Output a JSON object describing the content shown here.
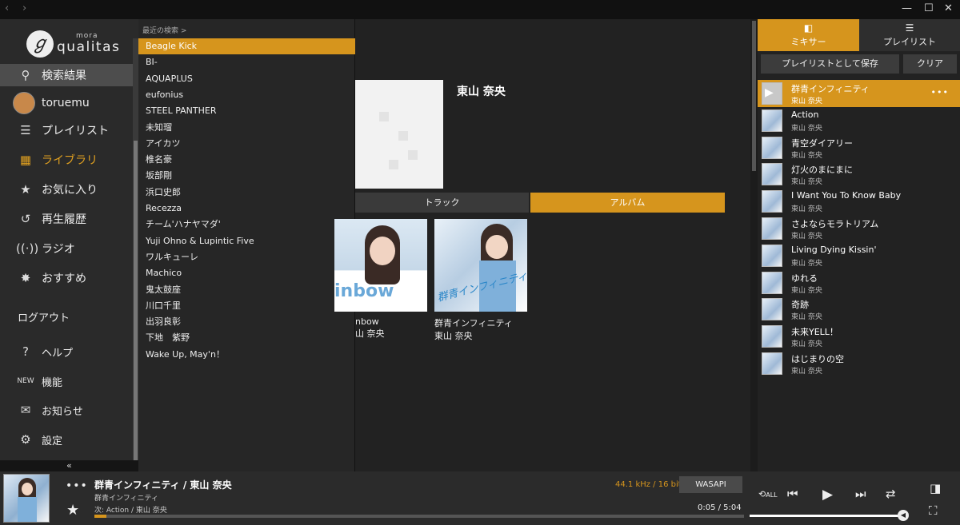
{
  "window": {
    "back": "‹",
    "forward": "›",
    "minimize": "—",
    "maximize": "☐",
    "close": "✕"
  },
  "sidebar": {
    "logo_small": "mora",
    "logo_main": "qualitas",
    "items": [
      {
        "label": "検索結果",
        "icon": "search-icon"
      },
      {
        "label": "toruemu",
        "icon": "avatar"
      },
      {
        "label": "プレイリスト",
        "icon": "playlist-icon"
      },
      {
        "label": "ライブラリ",
        "icon": "library-icon"
      },
      {
        "label": "お気に入り",
        "icon": "star-icon"
      },
      {
        "label": "再生履歴",
        "icon": "history-icon"
      },
      {
        "label": "ラジオ",
        "icon": "radio-icon"
      },
      {
        "label": "おすすめ",
        "icon": "recommend-icon"
      }
    ],
    "logout": "ログアウト",
    "lower_items": [
      {
        "label": "ヘルプ",
        "icon": "help-icon"
      },
      {
        "label": "機能",
        "icon": "new-icon"
      },
      {
        "label": "お知らせ",
        "icon": "mail-icon"
      },
      {
        "label": "設定",
        "icon": "gear-icon"
      }
    ],
    "collapse": "«"
  },
  "recent": {
    "header": "最近の検索 >",
    "items": [
      "Beagle Kick",
      "BI-",
      "AQUAPLUS",
      "eufonius",
      "STEEL PANTHER",
      "未知瑠",
      "アイカツ",
      "椎名豪",
      "坂部剛",
      "浜口史郎",
      "Recezza",
      "チーム'ハナヤマダ'",
      "Yuji Ohno & Lupintic Five",
      "ワルキューレ",
      "Machico",
      "鬼太鼓座",
      "川口千里",
      "出羽良彰",
      "下地　紫野",
      "Wake Up, May'n！"
    ]
  },
  "main": {
    "artist": "東山 奈央",
    "tabs": {
      "track": "トラック",
      "album": "アルバム"
    },
    "albums": [
      {
        "title": "nbow",
        "artist": "山 奈央",
        "art_text": "inbow"
      },
      {
        "title": "群青インフィニティ",
        "artist": "東山 奈央",
        "art_text": "群青インフィニティ"
      }
    ]
  },
  "right": {
    "tabs": {
      "mixer": "ミキサー",
      "playlist": "プレイリスト"
    },
    "save": "プレイリストとして保存",
    "clear": "クリア",
    "tracks": [
      {
        "title": "群青インフィニティ",
        "artist": "東山 奈央"
      },
      {
        "title": "Action",
        "artist": "東山 奈央"
      },
      {
        "title": "青空ダイアリー",
        "artist": "東山 奈央"
      },
      {
        "title": "灯火のまにまに",
        "artist": "東山 奈央"
      },
      {
        "title": "I Want You To Know Baby",
        "artist": "東山 奈央"
      },
      {
        "title": "さよならモラトリアム",
        "artist": "東山 奈央"
      },
      {
        "title": "Living Dying Kissin'",
        "artist": "東山 奈央"
      },
      {
        "title": "ゆれる",
        "artist": "東山 奈央"
      },
      {
        "title": "奇跡",
        "artist": "東山 奈央"
      },
      {
        "title": "未来YELL！",
        "artist": "東山 奈央"
      },
      {
        "title": "はじまりの空",
        "artist": "東山 奈央"
      }
    ],
    "more": "•••"
  },
  "player": {
    "title": "群青インフィニティ / 東山 奈央",
    "album": "群青インフィニティ",
    "next": "次: Action / 東山 奈央",
    "quality": "44.1 kHz / 16 bit",
    "output": "WASAPI",
    "time": "0:05 / 5:04",
    "progress": 0.017,
    "volume": 1.0,
    "more": "•••",
    "repeat_label": "ALL",
    "accent": "#d6951d"
  }
}
